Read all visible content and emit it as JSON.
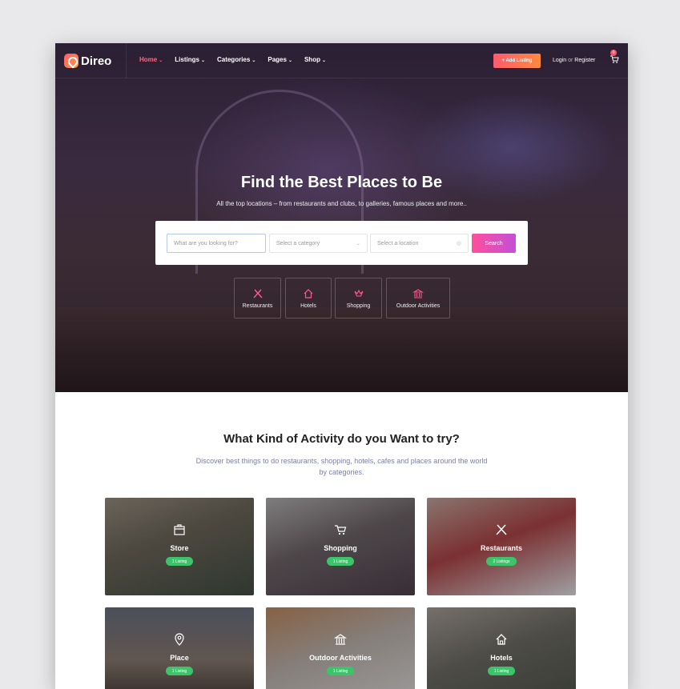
{
  "brand": {
    "name": "Direo",
    "accent": "#ff5a6e"
  },
  "nav": {
    "items": [
      {
        "label": "Home",
        "active": true
      },
      {
        "label": "Listings",
        "active": false
      },
      {
        "label": "Categories",
        "active": false
      },
      {
        "label": "Pages",
        "active": false
      },
      {
        "label": "Shop",
        "active": false
      }
    ],
    "add_listing": "+ Add Listing",
    "login": "Login",
    "or": "or",
    "register": "Register",
    "cart_count": "0"
  },
  "hero": {
    "title": "Find the Best Places to Be",
    "subtitle": "All the top locations – from restaurants and clubs, to galleries, famous places and more..",
    "search": {
      "keyword_placeholder": "What are you looking for?",
      "category_placeholder": "Select a category",
      "location_placeholder": "Select a location",
      "button": "Search"
    },
    "categories": [
      {
        "label": "Restaurants",
        "icon": "utensils-icon"
      },
      {
        "label": "Hotels",
        "icon": "home-icon"
      },
      {
        "label": "Shopping",
        "icon": "crown-icon"
      },
      {
        "label": "Outdoor Activities",
        "icon": "bank-icon"
      }
    ]
  },
  "activities": {
    "title": "What Kind of Activity do you Want to try?",
    "subtitle": "Discover best things to do restaurants, shopping, hotels, cafes and places around the world by categories.",
    "cards": [
      {
        "name": "Store",
        "count": "1 Listing",
        "icon": "store-icon"
      },
      {
        "name": "Shopping",
        "count": "1 Listing",
        "icon": "cart-icon"
      },
      {
        "name": "Restaurants",
        "count": "2 Listings",
        "icon": "utensils-icon"
      },
      {
        "name": "Place",
        "count": "1 Listing",
        "icon": "map-pin-icon"
      },
      {
        "name": "Outdoor Activities",
        "count": "1 Listing",
        "icon": "bank-icon"
      },
      {
        "name": "Hotels",
        "count": "1 Listing",
        "icon": "home-icon"
      }
    ]
  }
}
